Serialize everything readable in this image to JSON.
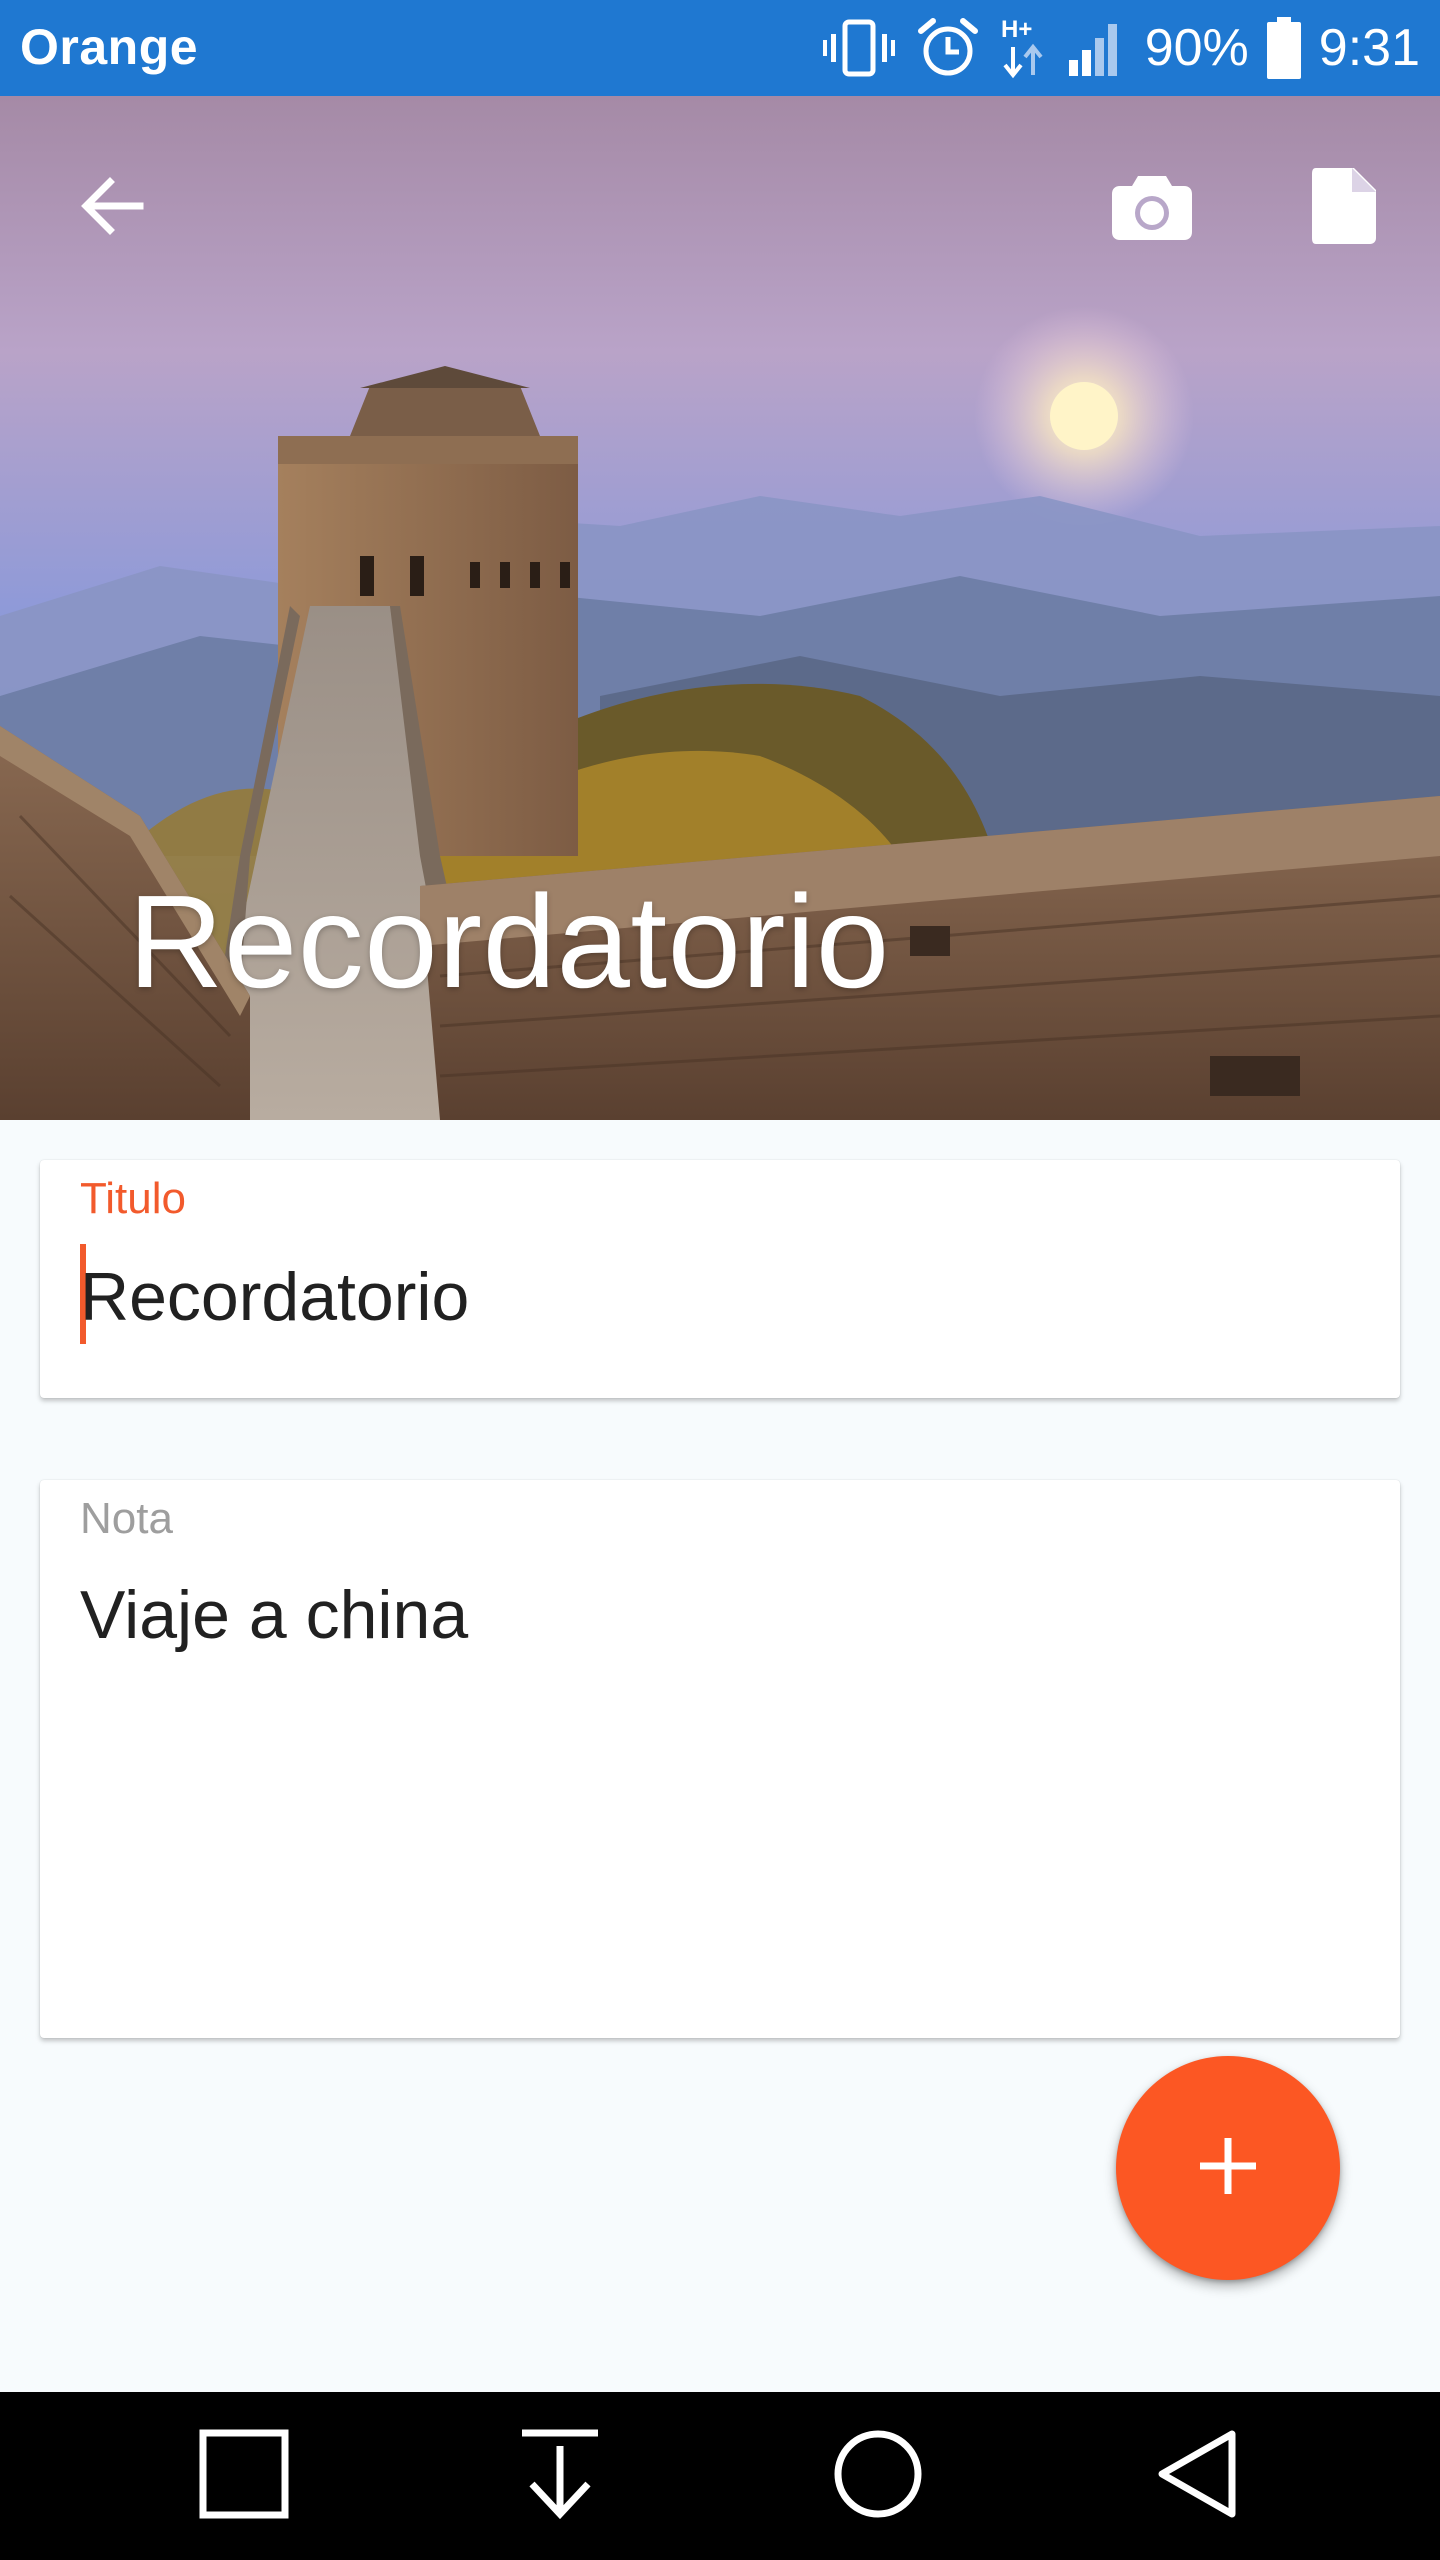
{
  "status_bar": {
    "carrier": "Orange",
    "battery": "90%",
    "time": "9:31",
    "network_badge": "H+",
    "icons": [
      "vibrate-icon",
      "alarm-icon",
      "data-h-plus-icon",
      "signal-icon",
      "battery-icon"
    ]
  },
  "header": {
    "title": "Recordatorio",
    "back_icon": "arrow-back-icon",
    "camera_icon": "camera-icon",
    "file_icon": "file-icon"
  },
  "form": {
    "title_label": "Titulo",
    "title_value": "Recordatorio",
    "note_label": "Nota",
    "note_value": "Viaje a china"
  },
  "fab": {
    "icon": "plus-icon"
  },
  "nav_bar": {
    "icons": [
      "recents-square-icon",
      "notification-pull-icon",
      "home-circle-icon",
      "back-triangle-icon"
    ]
  },
  "colors": {
    "status_bar": "#1f78d1",
    "accent": "#fc5723",
    "label_active": "#f25a2c",
    "label_inactive": "#9e9e9e",
    "background": "#f7fbfd",
    "nav_bar": "#000000"
  }
}
